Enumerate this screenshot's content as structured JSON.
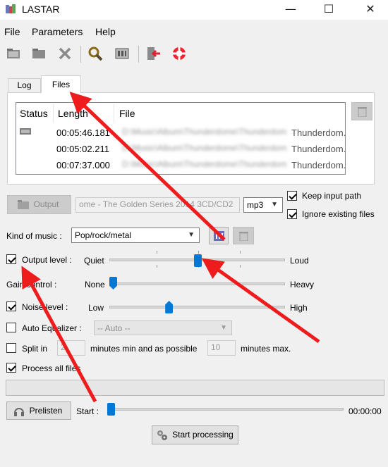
{
  "window": {
    "title": "LASTAR",
    "minimize": "—",
    "maximize": "☐",
    "close": "✕"
  },
  "menu": {
    "file": "File",
    "parameters": "Parameters",
    "help": "Help"
  },
  "toolbar": {
    "icons": [
      "open-folder-icon",
      "folder-icon",
      "delete-icon",
      "search-icon",
      "settings-icon",
      "exit-icon",
      "help-lifebuoy-icon"
    ]
  },
  "tabs": {
    "log": "Log",
    "files": "Files",
    "active": "Files"
  },
  "files_list": {
    "columns": [
      "Status",
      "Length",
      "File"
    ],
    "rows": [
      {
        "length": "00:05:46.181",
        "file_visible": "Thunderdom..."
      },
      {
        "length": "00:05:02.211",
        "file_visible": "Thunderdom..."
      },
      {
        "length": "00:07:37.000",
        "file_visible": "Thunderdom..."
      }
    ],
    "blur_placeholder": "D:\\Music\\Album\\Thunderdome\\Thunderdom"
  },
  "output": {
    "button_label": "Output",
    "path_value": "ome - The Golden Series 2014 3CD/CD2",
    "format_value": "mp3",
    "keep_input_path_label": "Keep input path",
    "keep_input_path_checked": true,
    "ignore_existing_label": "Ignore existing files",
    "ignore_existing_checked": true
  },
  "music": {
    "label": "Kind of music :",
    "value": "Pop/rock/metal"
  },
  "output_level": {
    "label": "Output level :",
    "checked": true,
    "min_label": "Quiet",
    "max_label": "Loud",
    "value": 0.5
  },
  "gain_control": {
    "label": "Gain control :",
    "min_label": "None",
    "max_label": "Heavy",
    "value": 0.0
  },
  "noise_level": {
    "label": "Noise level :",
    "checked": true,
    "min_label": "Low",
    "max_label": "High",
    "value": 0.33
  },
  "auto_eq": {
    "label": "Auto Equalizer :",
    "checked": false,
    "value": "-- Auto --"
  },
  "split": {
    "label": "Split in",
    "checked": false,
    "count": "2",
    "min_label": "minutes min and as possible",
    "max_value": "10",
    "max_label": "minutes max."
  },
  "process_all": {
    "label": "Process all files",
    "checked": true
  },
  "progress": {
    "value": 0.0
  },
  "prelisten": {
    "button_label": "Prelisten",
    "start_label": "Start :",
    "time": "00:00:00",
    "position": 0.0
  },
  "start_processing": {
    "button_label": "Start processing"
  },
  "colors": {
    "arrow": "#ee1c1c",
    "accent": "#0078d7"
  }
}
